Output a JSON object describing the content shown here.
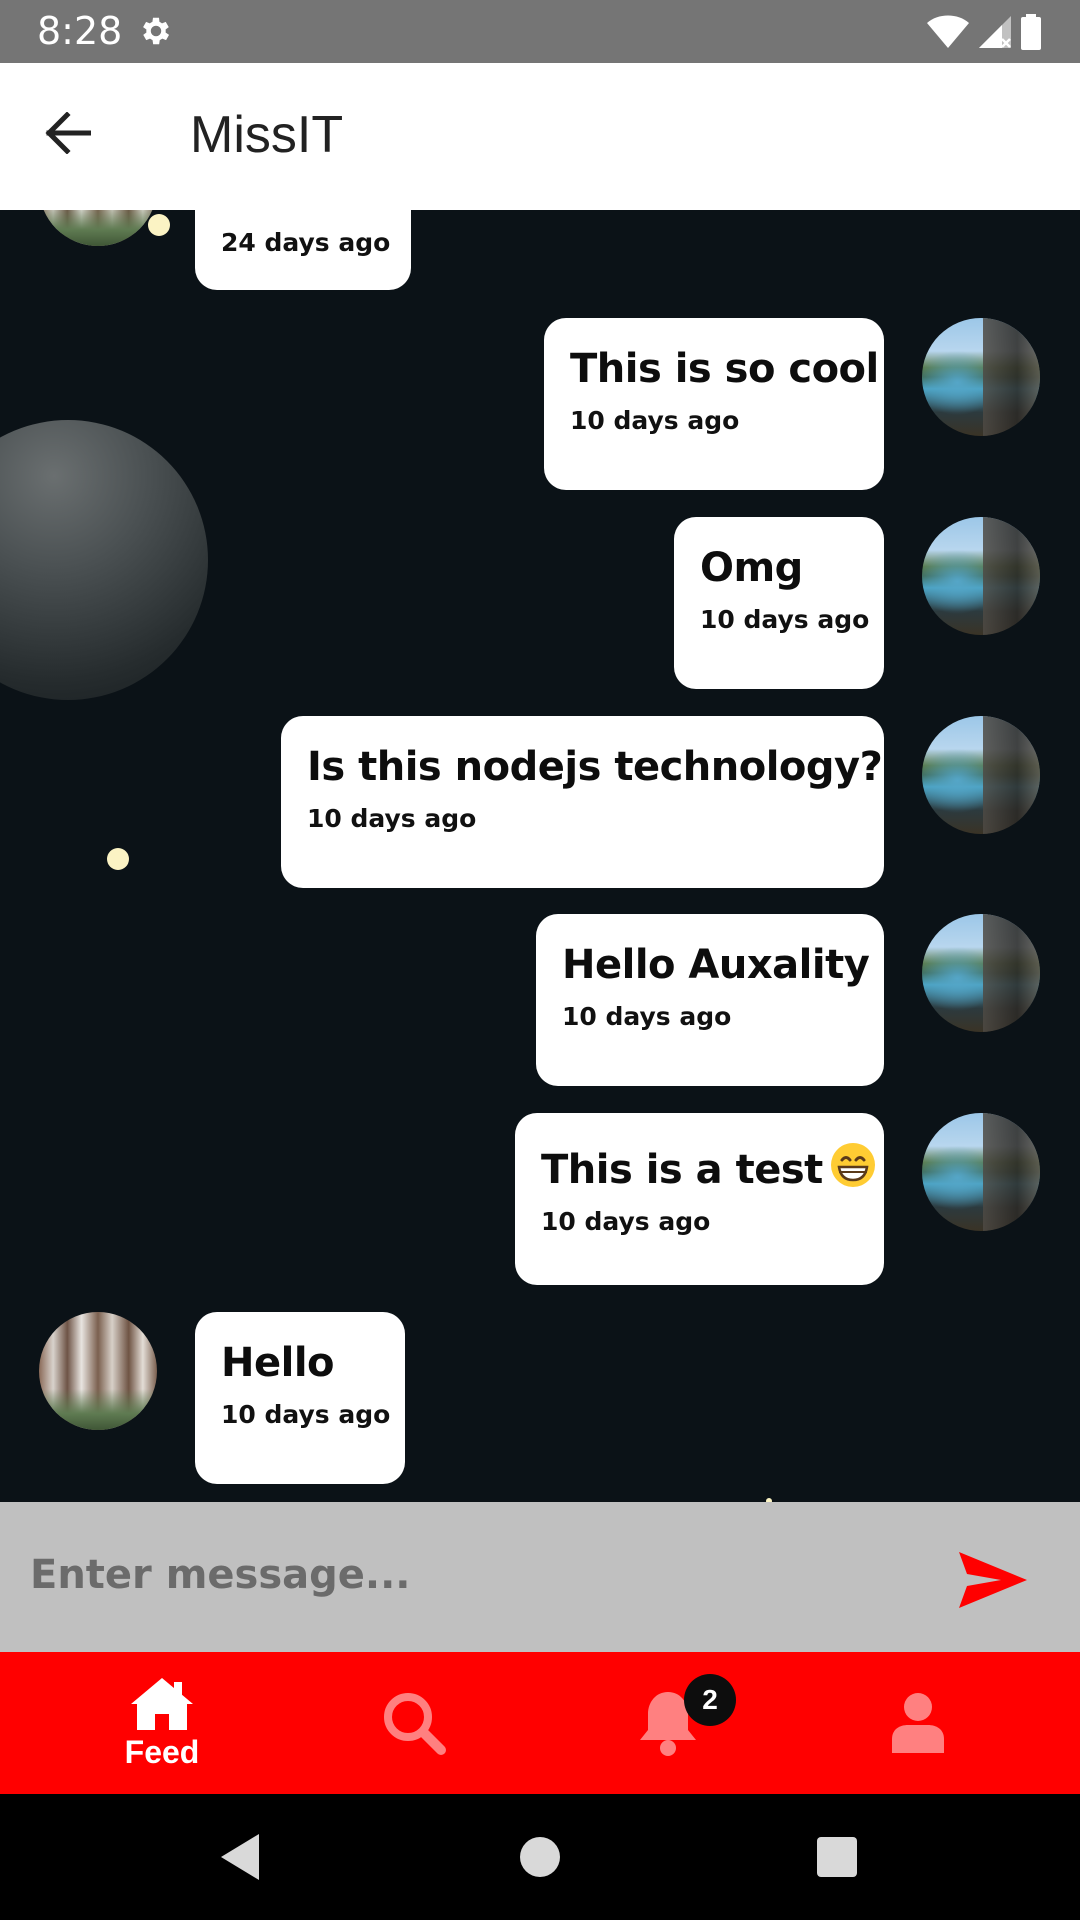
{
  "status_bar": {
    "time": "8:28",
    "icons": [
      "settings-gear-icon",
      "wifi-icon",
      "cell-signal-icon",
      "battery-icon"
    ]
  },
  "app_bar": {
    "title": "MissIT",
    "back_icon": "arrow-left-icon"
  },
  "messages": [
    {
      "sender": "other",
      "text": "",
      "time": "24 days ago"
    },
    {
      "sender": "me",
      "text": "This is so cool",
      "time": "10 days ago"
    },
    {
      "sender": "me",
      "text": "Omg",
      "time": "10 days ago"
    },
    {
      "sender": "me",
      "text": "Is this nodejs technology?",
      "time": "10 days ago"
    },
    {
      "sender": "me",
      "text": "Hello Auxality",
      "time": "10 days ago"
    },
    {
      "sender": "me",
      "text": "This is a test",
      "emoji": "grinning-face-emoji",
      "time": "10 days ago"
    },
    {
      "sender": "other",
      "text": "Hello",
      "time": "10 days ago"
    }
  ],
  "composer": {
    "placeholder": "Enter message...",
    "value": "",
    "send_icon": "send-icon"
  },
  "bottom_nav": {
    "items": [
      {
        "icon": "home-icon",
        "label": "Feed",
        "active": true
      },
      {
        "icon": "search-icon",
        "label": "",
        "active": false
      },
      {
        "icon": "bell-icon",
        "label": "",
        "active": false,
        "badge": "2"
      },
      {
        "icon": "user-icon",
        "label": "",
        "active": false
      }
    ]
  },
  "colors": {
    "accent": "#ff0000",
    "chat_background": "#0b1217",
    "bubble": "#ffffff",
    "input_bar": "#c0c0c0",
    "status_bar": "#757575"
  },
  "system_nav": [
    "back-triangle-icon",
    "home-circle-icon",
    "recents-square-icon"
  ]
}
